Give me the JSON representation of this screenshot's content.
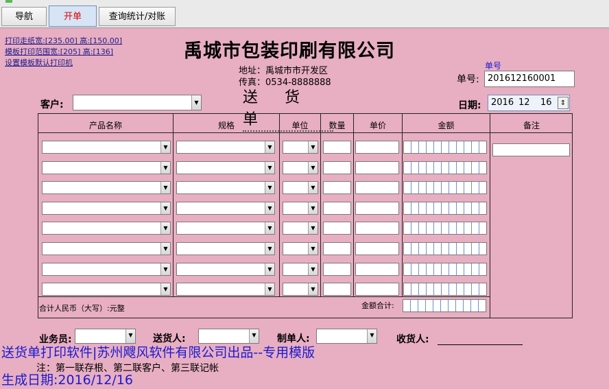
{
  "tabs": [
    {
      "label": "导航"
    },
    {
      "label": "开单"
    },
    {
      "label": "查询统计/对账"
    }
  ],
  "print_links": {
    "paper_size": "打印走纸宽:[235.00] 高:[150.00]",
    "template_range": "模板打印范围宽:[205] 高:[136]",
    "default_printer": "设置模板默认打印机"
  },
  "header": {
    "company": "禹城市包装印刷有限公司",
    "address": "地址：禹城市市开发区",
    "fax": "传真：0534-8888888",
    "doc_title": "送 货 单"
  },
  "order": {
    "no_caption": "单号",
    "no_label": "单号:",
    "no_value": "201612160001",
    "date_label": "日期:",
    "date_year": "2016",
    "date_month": "12",
    "date_day": "16"
  },
  "customer": {
    "label": "客户:",
    "value": ""
  },
  "table": {
    "columns": [
      "产品名称",
      "规格",
      "单位",
      "数量",
      "单价",
      "金额",
      "备注"
    ],
    "row_count": 8,
    "total_rmb_label": "合计人民币（大写）:元整",
    "total_amount_label": "金额合计:"
  },
  "signers": {
    "salesman": "业务员:",
    "deliverer": "送货人:",
    "maker": "制单人:",
    "receiver": "收货人:"
  },
  "footer": {
    "software": "送货单打印软件|苏州飕风软件有限公司出品--专用模版",
    "note": "注：第一联存根、第二联客户、第三联记帐",
    "generated": "生成日期:2016/12/16"
  }
}
